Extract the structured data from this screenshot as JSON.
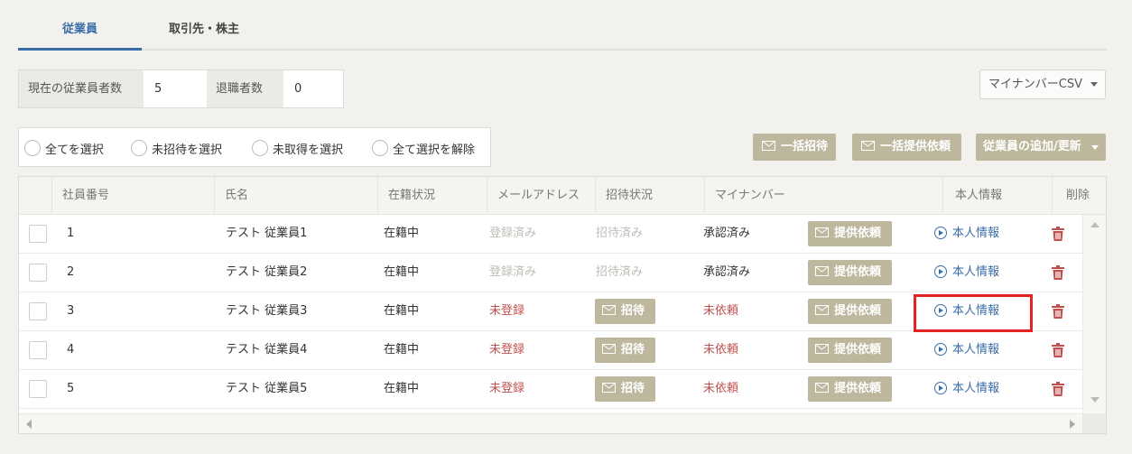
{
  "tabs": [
    {
      "label": "従業員",
      "active": true
    },
    {
      "label": "取引先・株主",
      "active": false
    }
  ],
  "counts": {
    "current_label": "現在の従業員者数",
    "current_value": "5",
    "retired_label": "退職者数",
    "retired_value": "0"
  },
  "csv_button": {
    "label": "マイナンバーCSV",
    "icon": "chevron-down-icon"
  },
  "selection": {
    "select_all": "全てを選択",
    "select_uninvited": "未招待を選択",
    "select_unacquired": "未取得を選択",
    "deselect_all": "全て選択を解除"
  },
  "actions": {
    "bulk_invite": "一括招待",
    "bulk_request": "一括提供依頼",
    "add_update": "従業員の追加/更新"
  },
  "columns": [
    "社員番号",
    "氏名",
    "在籍状況",
    "メールアドレス",
    "招待状況",
    "マイナンバー",
    "本人情報",
    "削除"
  ],
  "rows": [
    {
      "number": "1",
      "name": "テスト 従業員1",
      "status": "在籍中",
      "email": "登録済み",
      "invite": "招待済み",
      "mynumber": "承認済み",
      "request": "提供依頼",
      "info": "本人情報"
    },
    {
      "number": "2",
      "name": "テスト 従業員2",
      "status": "在籍中",
      "email": "登録済み",
      "invite": "招待済み",
      "mynumber": "承認済み",
      "request": "提供依頼",
      "info": "本人情報"
    },
    {
      "number": "3",
      "name": "テスト 従業員3",
      "status": "在籍中",
      "email": "未登録",
      "invite": "招待",
      "mynumber": "未依頼",
      "request": "提供依頼",
      "info": "本人情報"
    },
    {
      "number": "4",
      "name": "テスト 従業員4",
      "status": "在籍中",
      "email": "未登録",
      "invite": "招待",
      "mynumber": "未依頼",
      "request": "提供依頼",
      "info": "本人情報"
    },
    {
      "number": "5",
      "name": "テスト 従業員5",
      "status": "在籍中",
      "email": "未登録",
      "invite": "招待",
      "mynumber": "未依頼",
      "request": "提供依頼",
      "info": "本人情報"
    }
  ],
  "colors": {
    "accent": "#3b6ea8",
    "button": "#bdb79d",
    "danger": "#c0504d",
    "highlight": "#e52222"
  }
}
